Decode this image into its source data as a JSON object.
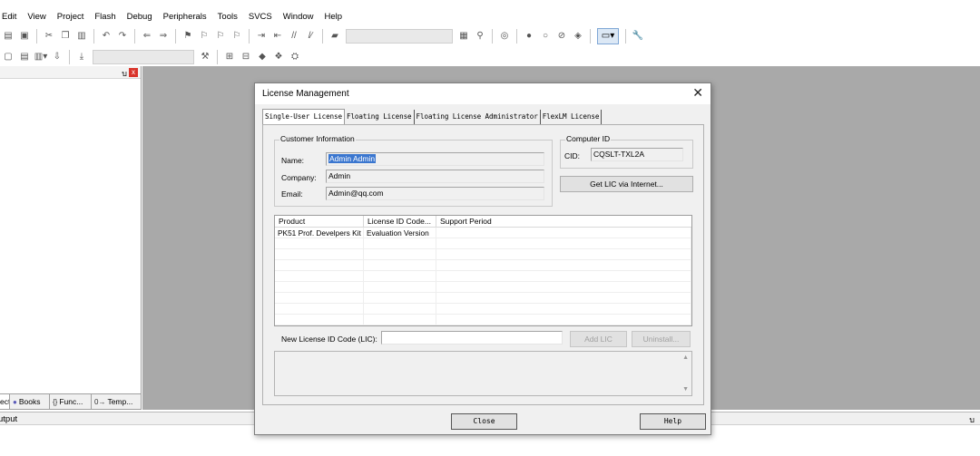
{
  "menubar": {
    "items": [
      "Edit",
      "View",
      "Project",
      "Flash",
      "Debug",
      "Peripherals",
      "Tools",
      "SVCS",
      "Window",
      "Help"
    ]
  },
  "project_panel": {
    "pin": "บ",
    "close": "x",
    "tabs": [
      {
        "label": "ect",
        "icon": ""
      },
      {
        "label": "Books",
        "icon": "●"
      },
      {
        "label": "Func...",
        "icon": "{}"
      },
      {
        "label": "Temp...",
        "icon": "0→"
      }
    ]
  },
  "output": {
    "label": "utput",
    "pin": "บ"
  },
  "dialog": {
    "title": "License Management",
    "close": "✕",
    "tabs": [
      "Single-User License",
      "Floating License",
      "Floating License Administrator",
      "FlexLM License"
    ],
    "customer": {
      "legend": "Customer Information",
      "name_label": "Name:",
      "name_value": "Admin Admin",
      "company_label": "Company:",
      "company_value": "Admin",
      "email_label": "Email:",
      "email_value": "Admin@qq.com"
    },
    "computer": {
      "legend": "Computer ID",
      "cid_label": "CID:",
      "cid_value": "CQSLT-TXL2A"
    },
    "get_lic_button": "Get LIC via Internet...",
    "table": {
      "columns": [
        "Product",
        "License ID Code...",
        "Support Period"
      ],
      "rows": [
        [
          "PK51 Prof. Develpers Kit",
          "Evaluation Version",
          ""
        ]
      ]
    },
    "new_lic_label": "New License ID Code (LIC):",
    "new_lic_value": "",
    "add_lic_button": "Add LIC",
    "uninstall_button": "Uninstall...",
    "close_button": "Close",
    "help_button": "Help"
  }
}
